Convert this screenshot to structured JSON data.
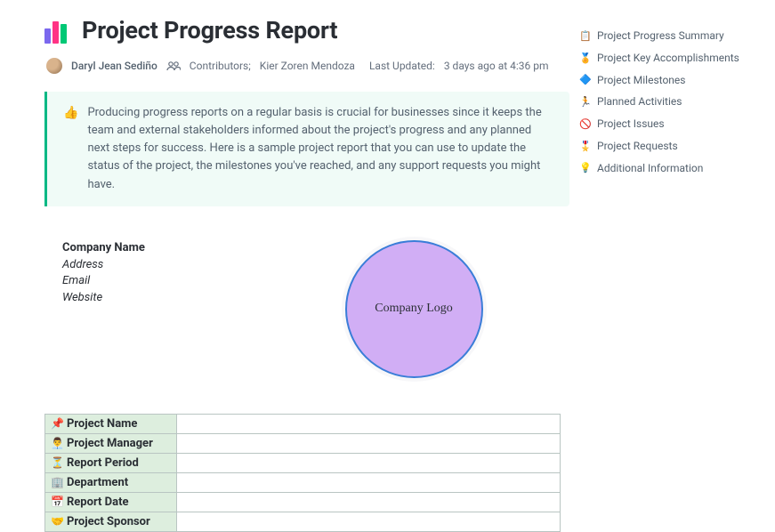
{
  "header": {
    "title": "Project Progress Report",
    "author": "Daryl Jean Sediño",
    "contributors_label": "Contributors;",
    "contributors": "Kier Zoren Mendoza",
    "updated_label": "Last Updated:",
    "updated_value": "3 days ago at 4:36 pm"
  },
  "callout": {
    "emoji": "👍",
    "text": "Producing progress reports on a regular basis is crucial for businesses since it keeps the team and external stakeholders informed about the project's progress and any planned next steps for success. Here is a sample project report that you can use to update the status of the project, the milestones you've reached, and any support requests you might have."
  },
  "company": {
    "name_label": "Company Name",
    "address_label": "Address",
    "email_label": "Email",
    "website_label": "Website",
    "logo_text": "Company Logo"
  },
  "info_rows": [
    {
      "icon": "📌",
      "label": "Project Name",
      "value": ""
    },
    {
      "icon": "👨‍💼",
      "label": "Project Manager",
      "value": ""
    },
    {
      "icon": "⏳",
      "label": "Report Period",
      "value": ""
    },
    {
      "icon": "🏢",
      "label": "Department",
      "value": ""
    },
    {
      "icon": "📅",
      "label": "Report Date",
      "value": ""
    },
    {
      "icon": "🤝",
      "label": "Project Sponsor",
      "value": ""
    }
  ],
  "toc": [
    {
      "icon": "📋",
      "label": "Project Progress Summary"
    },
    {
      "icon": "🏅",
      "label": "Project Key Accomplishments"
    },
    {
      "icon": "🔷",
      "label": "Project Milestones"
    },
    {
      "icon": "🏃",
      "label": "Planned Activities"
    },
    {
      "icon": "🚫",
      "label": "Project Issues"
    },
    {
      "icon": "🎖️",
      "label": "Project Requests"
    },
    {
      "icon": "💡",
      "label": "Additional Information"
    }
  ]
}
